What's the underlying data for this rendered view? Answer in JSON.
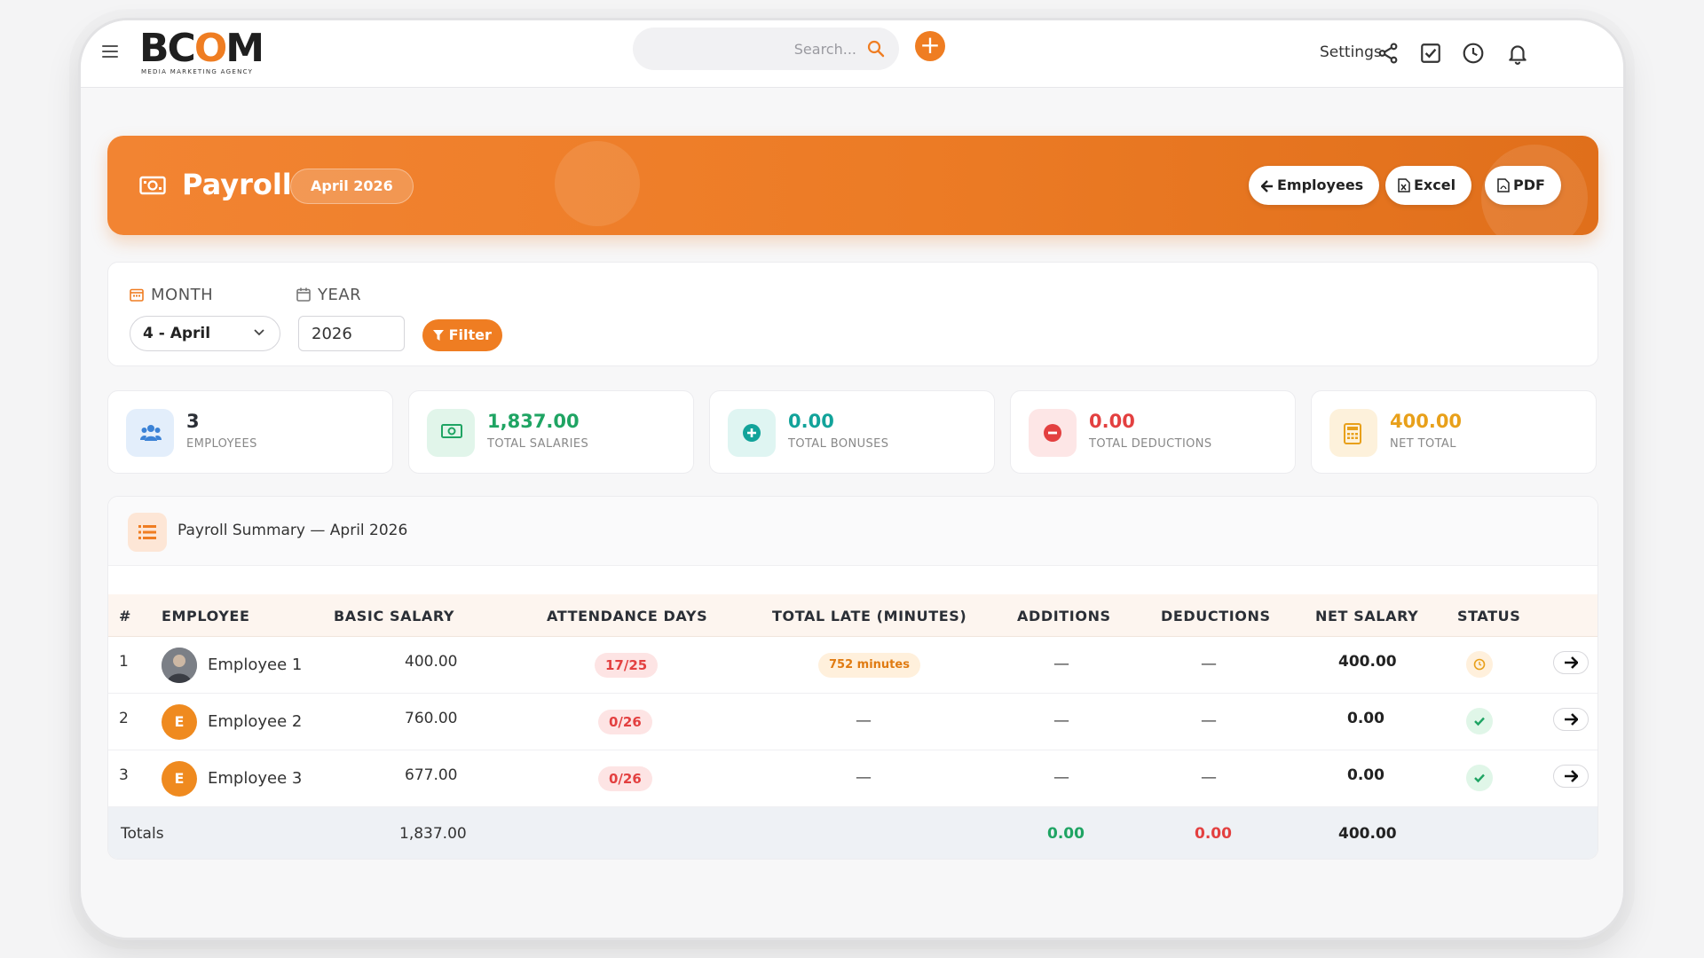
{
  "header": {
    "logo_text": "BCOM",
    "logo_tagline": "MEDIA MARKETING AGENCY",
    "search_placeholder": "Search...",
    "settings_label": "Settings",
    "icons": [
      "menu-icon",
      "search-icon",
      "plus-icon",
      "share-icon",
      "checkbox-icon",
      "clock-icon",
      "bell-icon"
    ]
  },
  "banner": {
    "title": "Payroll",
    "period": "April 2026",
    "buttons": {
      "employees": "Employees",
      "excel": "Excel",
      "pdf": "PDF"
    }
  },
  "filters": {
    "month_label": "MONTH",
    "year_label": "YEAR",
    "month_value": "4 - April",
    "year_value": "2026",
    "filter_button": "Filter"
  },
  "stats": [
    {
      "value": "3",
      "label": "EMPLOYEES",
      "color": "#2b2f36",
      "icon": "users-icon"
    },
    {
      "value": "1,837.00",
      "label": "TOTAL SALARIES",
      "color": "#1fa463",
      "icon": "money-icon"
    },
    {
      "value": "0.00",
      "label": "TOTAL BONUSES",
      "color": "#12a39a",
      "icon": "plus-circle-icon"
    },
    {
      "value": "0.00",
      "label": "TOTAL DEDUCTIONS",
      "color": "#e34040",
      "icon": "minus-circle-icon"
    },
    {
      "value": "400.00",
      "label": "NET TOTAL",
      "color": "#e8a01a",
      "icon": "calculator-icon"
    }
  ],
  "table": {
    "title": "Payroll Summary — April 2026",
    "columns": [
      "#",
      "EMPLOYEE",
      "BASIC SALARY",
      "ATTENDANCE DAYS",
      "TOTAL LATE (MINUTES)",
      "ADDITIONS",
      "DEDUCTIONS",
      "NET SALARY",
      "STATUS"
    ],
    "rows": [
      {
        "num": "1",
        "avatar": "",
        "name": "Employee 1",
        "basic": "400.00",
        "attendance": "17/25",
        "late": "752 minutes",
        "additions": "—",
        "deductions": "—",
        "net": "400.00",
        "status": "pending"
      },
      {
        "num": "2",
        "avatar": "E",
        "name": "Employee 2",
        "basic": "760.00",
        "attendance": "0/26",
        "late": "—",
        "additions": "—",
        "deductions": "—",
        "net": "0.00",
        "status": "paid"
      },
      {
        "num": "3",
        "avatar": "E",
        "name": "Employee 3",
        "basic": "677.00",
        "attendance": "0/26",
        "late": "—",
        "additions": "—",
        "deductions": "—",
        "net": "0.00",
        "status": "paid"
      }
    ],
    "totals": {
      "label": "Totals",
      "basic": "1,837.00",
      "additions": "0.00",
      "deductions": "0.00",
      "net": "400.00"
    }
  },
  "colors": {
    "accent": "#ef7d22",
    "success": "#1fa463",
    "danger": "#e34040",
    "warning": "#e8a01a"
  }
}
